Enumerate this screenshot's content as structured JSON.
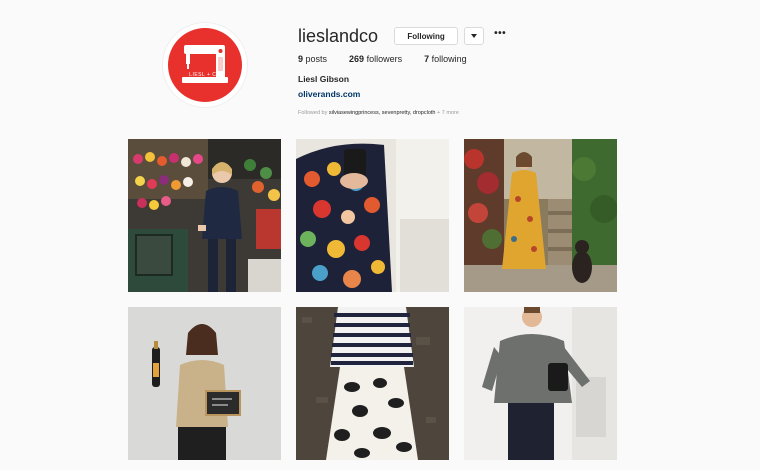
{
  "profile": {
    "username": "lieslandco",
    "follow_label": "Following",
    "more_label": "•••",
    "avatar_text": "LIESL + CO",
    "posts_count": "9",
    "posts_label": "posts",
    "followers_count": "269",
    "followers_label": "followers",
    "following_count": "7",
    "following_label": "following",
    "full_name": "Liesl Gibson",
    "website": "oliverands.com",
    "followed_by_prefix": "Followed by",
    "followed_by_names": "silviasewingprincess, sevenpretty, dropcloth",
    "followed_by_more": "+ 7 more"
  },
  "posts": [
    {
      "icon": "photo-woman-flower-shop"
    },
    {
      "icon": "photo-floral-dress-mirror-selfie"
    },
    {
      "icon": "photo-yellow-floral-dress-garden"
    },
    {
      "icon": "photo-woman-champagne-chalkboard"
    },
    {
      "icon": "photo-striped-top-print-skirt"
    },
    {
      "icon": "photo-grey-sweatshirt-mirror"
    }
  ],
  "colors": {
    "background": "#fafafa",
    "link": "#003569",
    "brand_red": "#e8312c",
    "muted": "#999999"
  }
}
